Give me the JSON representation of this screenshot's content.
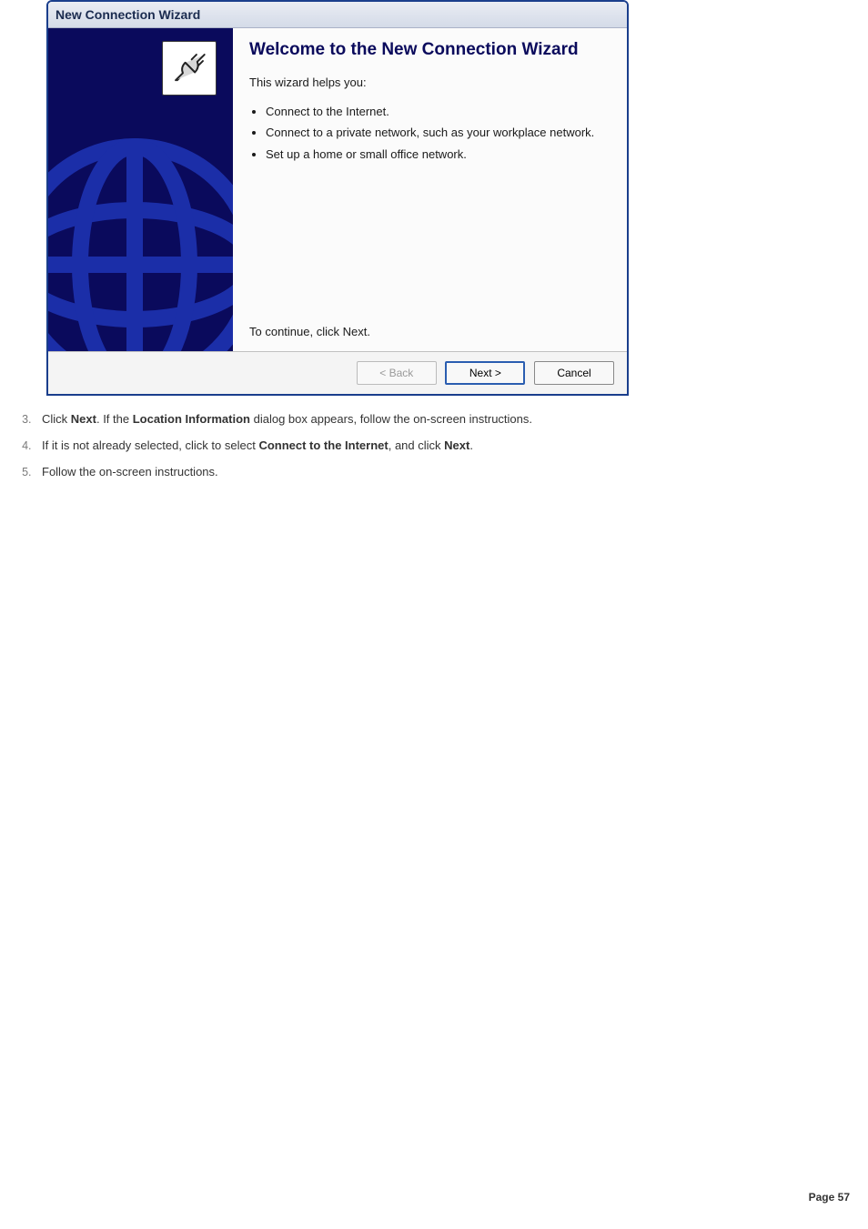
{
  "dialog": {
    "title": "New Connection Wizard",
    "heading": "Welcome to the New Connection Wizard",
    "intro": "This wizard helps you:",
    "bullets": [
      "Connect to the Internet.",
      "Connect to a private network, such as your workplace network.",
      "Set up a home or small office network."
    ],
    "continue_text": "To continue, click Next.",
    "buttons": {
      "back": "< Back",
      "next": "Next >",
      "cancel": "Cancel"
    },
    "icon_name": "connection-plug-icon"
  },
  "instructions": [
    {
      "segments": [
        {
          "t": "Click "
        },
        {
          "t": "Next",
          "b": true
        },
        {
          "t": ". If the "
        },
        {
          "t": "Location Information",
          "b": true
        },
        {
          "t": " dialog box appears, follow the on-screen instructions."
        }
      ]
    },
    {
      "segments": [
        {
          "t": "If it is not already selected, click to select "
        },
        {
          "t": "Connect to the Internet",
          "b": true
        },
        {
          "t": ", and click "
        },
        {
          "t": "Next",
          "b": true
        },
        {
          "t": "."
        }
      ]
    },
    {
      "segments": [
        {
          "t": "Follow the on-screen instructions."
        }
      ]
    }
  ],
  "page_label": "Page 57"
}
